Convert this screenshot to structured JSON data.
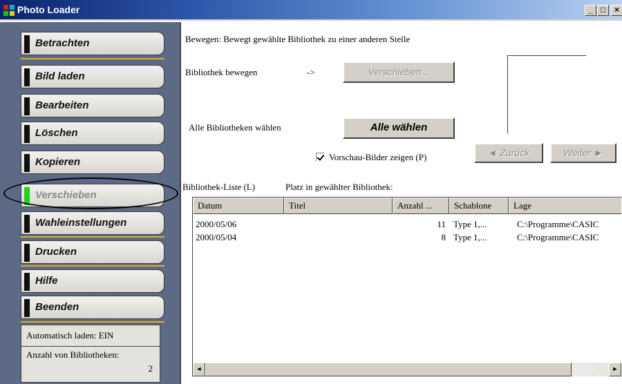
{
  "window": {
    "title": "Photo Loader",
    "controls": {
      "minimize": "_",
      "maximize": "□",
      "close": "×"
    }
  },
  "sidebar": {
    "items": [
      {
        "label": "Betrachten",
        "enabled": true
      },
      {
        "label": "Bild laden",
        "enabled": true
      },
      {
        "label": "Bearbeiten",
        "enabled": true
      },
      {
        "label": "Löschen",
        "enabled": true
      },
      {
        "label": "Kopieren",
        "enabled": true
      },
      {
        "label": "Verschieben",
        "enabled": false,
        "highlighted": true
      },
      {
        "label": "Wahleinstellungen",
        "enabled": true
      },
      {
        "label": "Drucken",
        "enabled": true
      },
      {
        "label": "Hilfe",
        "enabled": true
      },
      {
        "label": "Beenden",
        "enabled": true
      }
    ],
    "autoload": "Automatisch laden: EIN",
    "library_count_label": "Anzahl von Bibliotheken:",
    "library_count_value": "2"
  },
  "main": {
    "description": "Bewegen: Bewegt gewählte Bibliothek zu einer anderen Stelle",
    "move_label": "Bibliothek bewegen",
    "move_arrow": "->",
    "move_button": "Verschieben...",
    "select_all_label": "Alle Bibliotheken wählen",
    "select_all_button": "Alle wählen",
    "preview_checkbox": "Vorschau-Bilder zeigen (P)",
    "preview_checked": true,
    "back_button": "◄ Zurück",
    "next_button": "Weiter ►",
    "list_label": "Bibliothek-Liste (L)",
    "place_label": "Platz in gewählter Bibliothek:",
    "columns": [
      "Datum",
      "Titel",
      "Anzahl ...",
      "Schablone",
      "Lage"
    ],
    "rows": [
      {
        "datum": "2000/05/06",
        "titel": "",
        "anzahl": "11",
        "schablone": "Type 1,...",
        "lage": "C:\\Programme\\CASIC"
      },
      {
        "datum": "2000/05/04",
        "titel": "",
        "anzahl": "8",
        "schablone": "Type 1,...",
        "lage": "C:\\Programme\\CASIC"
      }
    ]
  },
  "colors": {
    "titlebar_start": "#0a246a",
    "sidebar_bg": "#5c6a86",
    "divider_gold": "#e0b020",
    "disabled_notch": "#1fd31f"
  }
}
